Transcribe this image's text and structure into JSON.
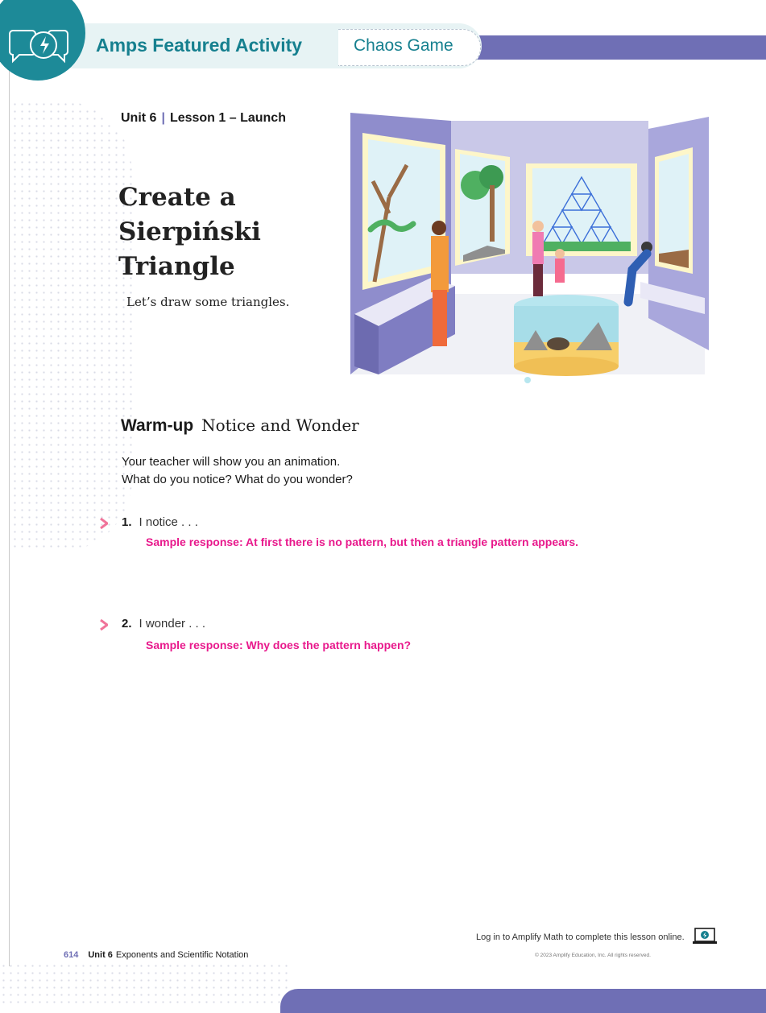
{
  "header": {
    "activity_title": "Amps Featured Activity",
    "activity_name": "Chaos Game"
  },
  "lesson": {
    "unit": "Unit 6",
    "separator": "|",
    "lesson": "Lesson 1 – Launch"
  },
  "title": {
    "line1": "Create a",
    "line2": "Sierpiński",
    "line3": "Triangle"
  },
  "subtitle": "Let’s draw some triangles.",
  "warmup": {
    "label": "Warm-up",
    "name": "Notice and Wonder",
    "prompt_line1": "Your teacher will show you an animation.",
    "prompt_line2": "What do you notice? What do you wonder?"
  },
  "questions": [
    {
      "number": "1.",
      "label": "I notice . . .",
      "answer": "Sample response: At first there is no pattern, but then a triangle pattern appears."
    },
    {
      "number": "2.",
      "label": "I wonder . . .",
      "answer": "Sample response: Why does the pattern happen?"
    }
  ],
  "footer": {
    "login": "Log in to Amplify Math to complete this lesson online.",
    "copyright": "© 2023 Amplify Education, Inc. All rights reserved.",
    "page_number": "614",
    "unit": "Unit 6",
    "unit_title": "Exponents and Scientific Notation"
  },
  "colors": {
    "teal": "#16808f",
    "purple": "#6f6fb5",
    "answer_pink": "#e8198c",
    "arrow_pink": "#f0749a"
  },
  "icons": [
    "amps-logo-icon",
    "arrow-icon",
    "laptop-icon"
  ]
}
